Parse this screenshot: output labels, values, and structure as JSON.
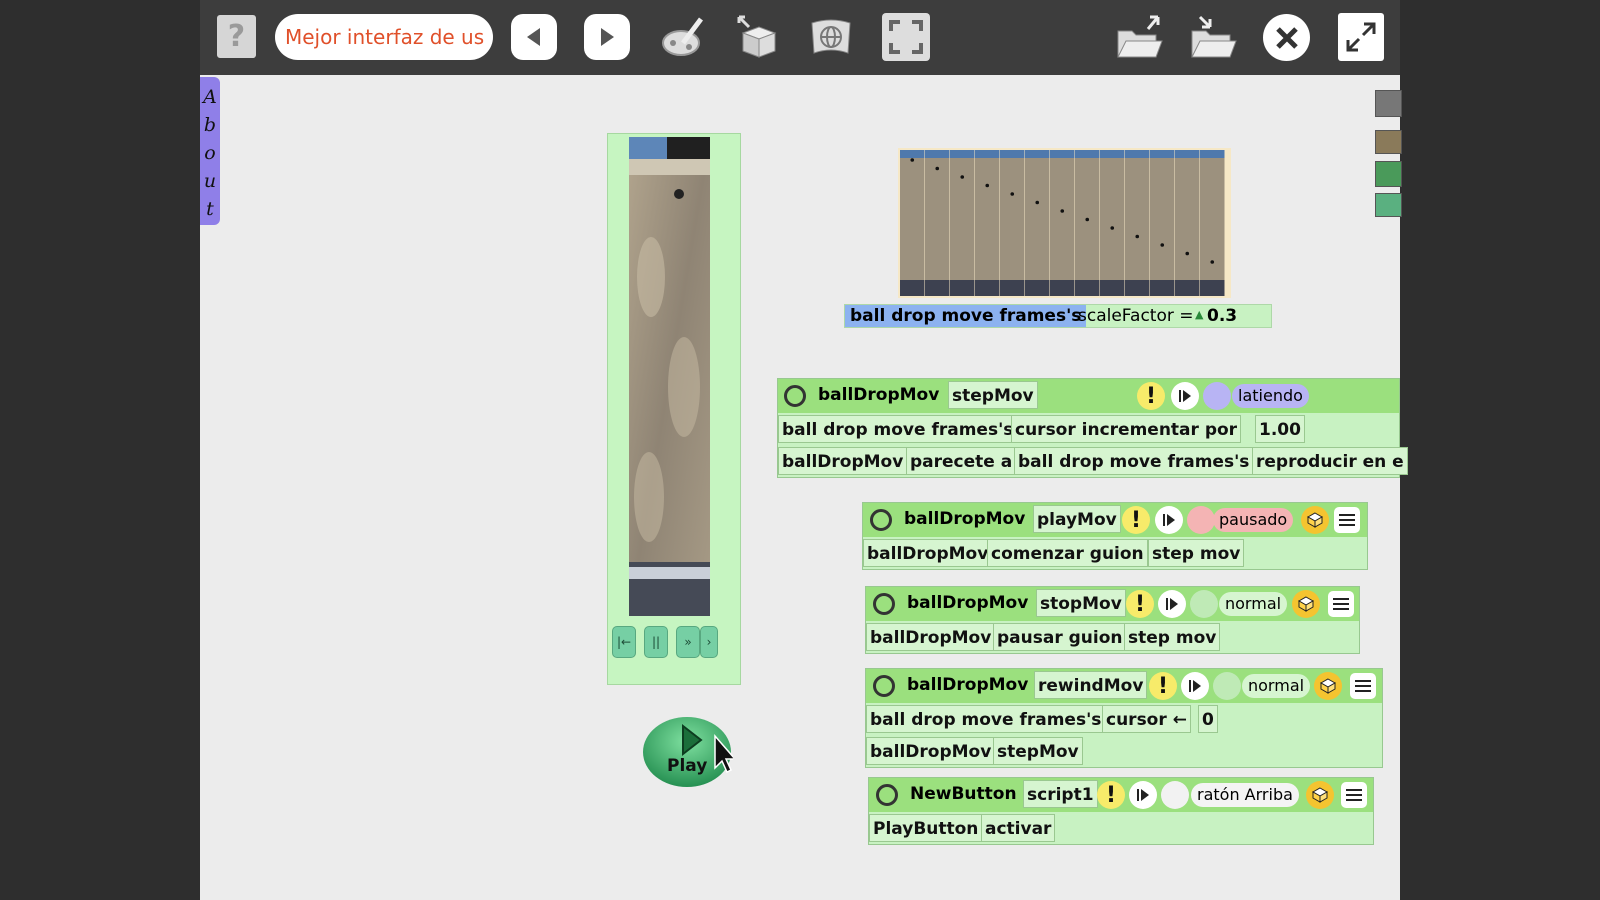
{
  "toolbar": {
    "help_label": "?",
    "project_name": "Mejor interfaz de us",
    "icons": [
      "question-icon",
      "previous-project-icon",
      "next-project-icon",
      "paint-icon",
      "new-object-icon",
      "web-icon",
      "fullscreen-frame-icon",
      "load-project-icon",
      "save-project-icon",
      "close-icon",
      "expand-icon"
    ]
  },
  "about_flap": {
    "letters": [
      "A",
      "b",
      "o",
      "u",
      "t"
    ]
  },
  "movie_player": {
    "controls": [
      "|←",
      "||",
      "»",
      "›"
    ]
  },
  "play_button": {
    "label": "Play"
  },
  "frame_strip": {
    "frame_count": 13,
    "readout_object": "ball drop move frames's",
    "readout_slot": "scaleFactor =",
    "readout_value": "0.3"
  },
  "scripts": [
    {
      "object": "ballDropMov",
      "name": "stepMov",
      "status": "latiendo",
      "status_color": "#b8b4f4",
      "rows": [
        [
          "ball drop move frames's",
          "cursor incrementar por",
          "1.00"
        ],
        [
          "ballDropMov",
          "parecete a",
          "ball drop move frames's",
          "reproducir en e"
        ]
      ]
    },
    {
      "object": "ballDropMov",
      "name": "playMov",
      "status": "pausado",
      "status_color": "#f4b4b4",
      "rows": [
        [
          "ballDropMov",
          "comenzar guion",
          "step mov"
        ]
      ]
    },
    {
      "object": "ballDropMov",
      "name": "stopMov",
      "status": "normal",
      "status_color": "#d6f5d0",
      "rows": [
        [
          "ballDropMov",
          "pausar guion",
          "step mov"
        ]
      ]
    },
    {
      "object": "ballDropMov",
      "name": "rewindMov",
      "status": "normal",
      "status_color": "#d6f5d0",
      "rows": [
        [
          "ball drop move frames's",
          "cursor ←",
          "0"
        ],
        [
          "ballDropMov",
          "stepMov"
        ]
      ]
    },
    {
      "object": "NewButton",
      "name": "script1",
      "status": "ratón Arriba",
      "status_color": "#f4f4f4",
      "rows": [
        [
          "PlayButton",
          "activar"
        ]
      ]
    }
  ],
  "colors": {
    "accent_text": "#e0502a",
    "script_header": "#9be07e",
    "script_body": "#c8f2c2",
    "flap_purple": "#8f7fe8"
  }
}
